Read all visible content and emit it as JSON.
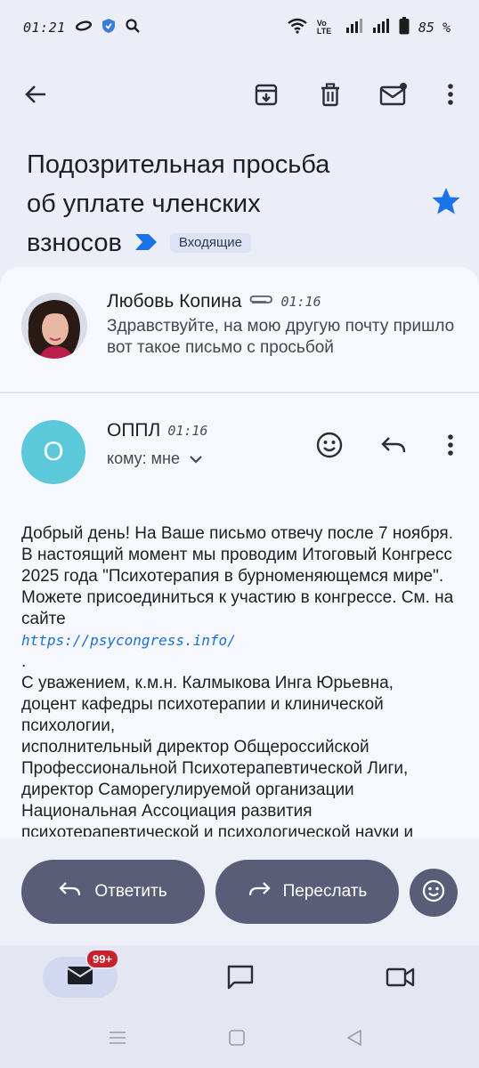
{
  "status_bar": {
    "time": "01:21",
    "battery_percent": "85 %",
    "network_label": "Vo LTE"
  },
  "toolbar": {
    "back_icon": "arrow-left",
    "archive_icon": "archive",
    "delete_icon": "trash",
    "unread_icon": "mail-unread",
    "more_icon": "more-vertical"
  },
  "subject": {
    "line1": "Подозрительная просьба",
    "line2": "об уплате членских",
    "line3": "взносов",
    "label": "Входящие",
    "starred": true,
    "star_color": "#1a73e8"
  },
  "messages": [
    {
      "sender": "Любовь Копина",
      "time": "01:16",
      "has_attachment": true,
      "snippet": "Здравствуйте, на мою другую почту пришло вот такое письмо с просьбой"
    },
    {
      "sender": "ОППЛ",
      "avatar_letter": "О",
      "avatar_color": "#5cc9db",
      "time": "01:16",
      "to": "кому: мне",
      "body": {
        "p1": "Добрый день! На Ваше письмо отвечу после 7 ноября. В настоящий момент мы проводим Итоговый Конгресс 2025 года \"Психотерапия в бурноменяющемся мире\". Можете присоединиться к участию в конгрессе. См. на сайте",
        "link": "https://psycongress.info/",
        "dot": ".",
        "sig1": "С уважением, к.м.н. Калмыкова Инга Юрьевна,",
        "sig2": "доцент кафедры психотерапии и клинической психологии,",
        "sig3": "исполнительный директор Общероссийской Профессиональной Психотерапевтической Лиги,",
        "sig4": "директор Саморегулируемой организации Национальная Ассоциация развития психотерапевтической и психологической науки и"
      }
    }
  ],
  "actions": {
    "reply": "Ответить",
    "forward": "Переслать"
  },
  "bottom_nav": {
    "mail_badge": "99+",
    "badge_color": "#c8232c"
  }
}
